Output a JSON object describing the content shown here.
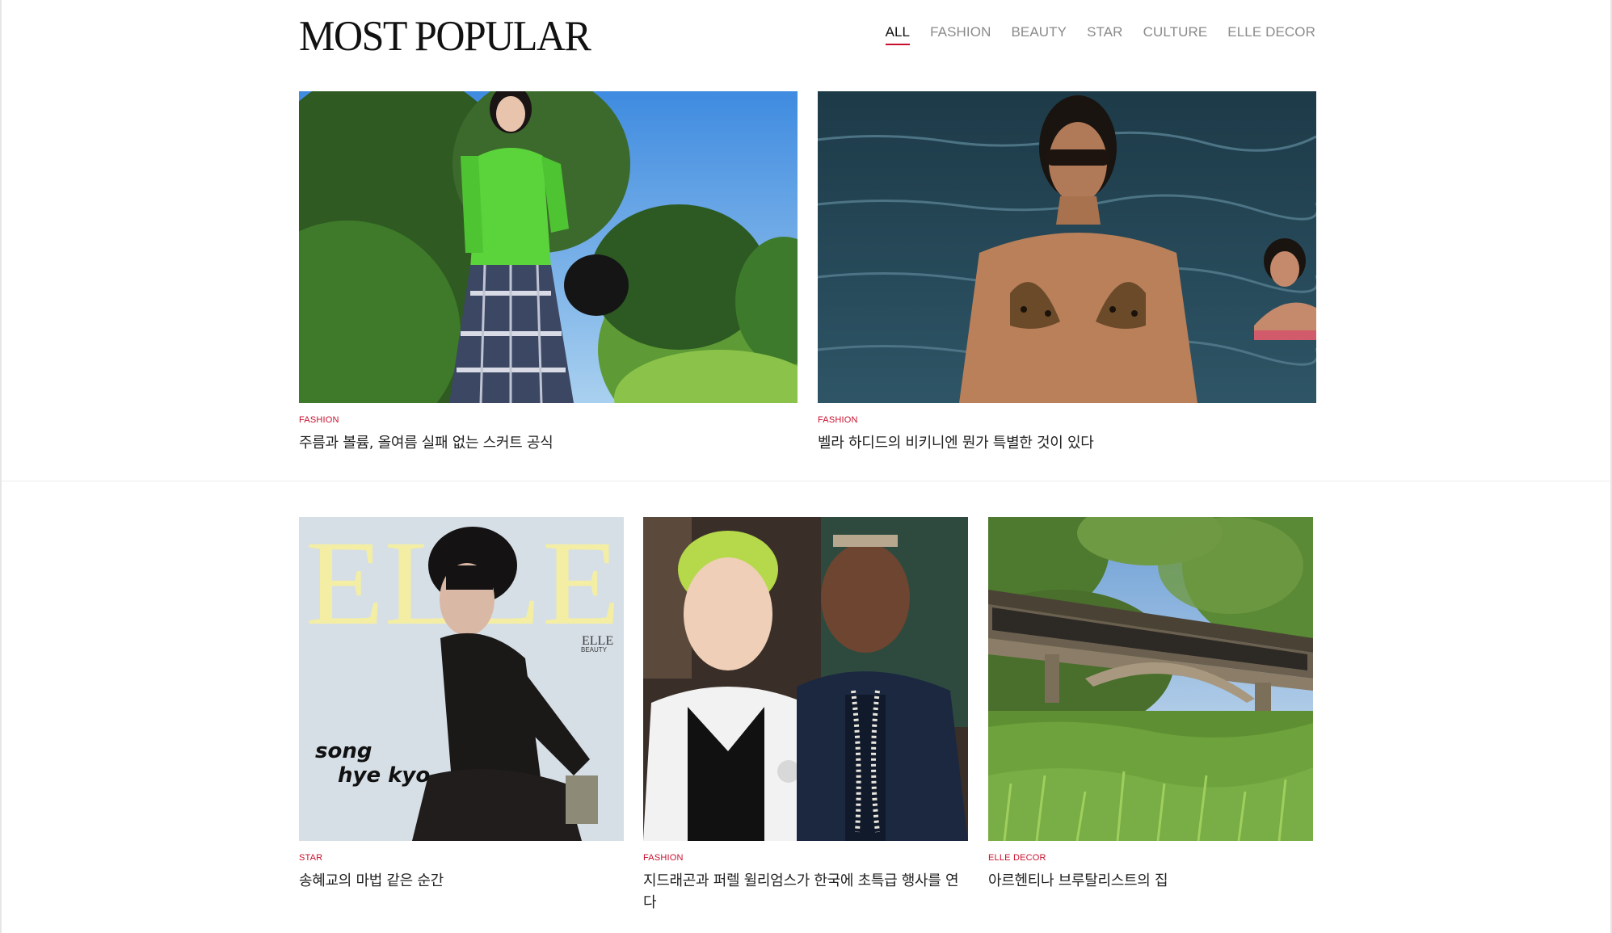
{
  "section": {
    "title": "MOST POPULAR"
  },
  "tabs": [
    {
      "label": "ALL",
      "active": true
    },
    {
      "label": "FASHION",
      "active": false
    },
    {
      "label": "BEAUTY",
      "active": false
    },
    {
      "label": "STAR",
      "active": false
    },
    {
      "label": "CULTURE",
      "active": false
    },
    {
      "label": "ELLE DECOR",
      "active": false
    }
  ],
  "colors": {
    "accent": "#c8102e",
    "tab_inactive": "#8a8a8a",
    "text": "#222222"
  },
  "articles": [
    {
      "category": "FASHION",
      "headline": "주름과 볼륨, 올여름 실패 없는 스커트 공식",
      "image": "woman-green-top-plaid-skirt-photo"
    },
    {
      "category": "FASHION",
      "headline": "벨라 하디드의 비키니엔 뭔가 특별한 것이 있다",
      "image": "woman-leopard-bikini-water-photo"
    },
    {
      "category": "STAR",
      "headline": "송혜교의 마법 같은 순간",
      "image": "elle-cover-song-hye-kyo-photo",
      "cover_text": {
        "masthead": "ELLE",
        "sub_masthead": "ELLE",
        "sub_label": "BEAUTY",
        "name_line_1": "song",
        "name_line_2": "hye kyo"
      }
    },
    {
      "category": "FASHION",
      "headline": "지드래곤과 퍼렐 윌리엄스가 한국에 초특급 행사를 연다",
      "image": "two-men-event-photo"
    },
    {
      "category": "ELLE DECOR",
      "headline": "아르헨티나 브루탈리스트의 집",
      "image": "brutalist-bridge-house-photo"
    }
  ]
}
